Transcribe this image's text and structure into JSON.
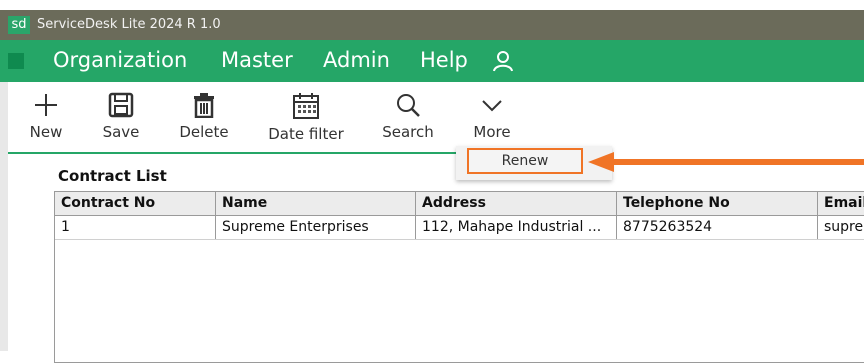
{
  "window": {
    "logo_text": "sd",
    "title": "ServiceDesk Lite 2024 R 1.0"
  },
  "menu": {
    "items": [
      {
        "label": "Organization",
        "icon": "organization-menu"
      },
      {
        "label": "Master",
        "icon": "master-menu"
      },
      {
        "label": "Admin",
        "icon": "admin-menu"
      },
      {
        "label": "Help",
        "icon": "help-menu"
      }
    ],
    "user_icon": "user-icon"
  },
  "toolbar": {
    "new_label": "New",
    "save_label": "Save",
    "delete_label": "Delete",
    "date_filter_label": "Date filter",
    "search_label": "Search",
    "more_label": "More"
  },
  "dropdown": {
    "renew_label": "Renew"
  },
  "contract_list": {
    "title": "Contract List",
    "columns": [
      "Contract No",
      "Name",
      "Address",
      "Telephone No",
      "Email"
    ],
    "rows": [
      [
        "1",
        "Supreme Enterprises",
        "112, Mahape Industrial ...",
        "8775263524",
        "supren"
      ]
    ]
  },
  "colors": {
    "menu_bar": "#25a667",
    "title_bar": "#6b6b5a",
    "highlight": "#f07426"
  }
}
